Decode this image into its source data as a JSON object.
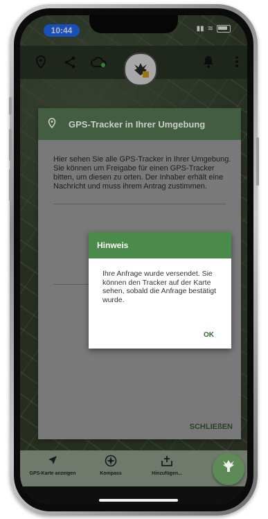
{
  "status_bar": {
    "time": "10:44"
  },
  "toolbar": {
    "icons": [
      "map-pin-icon",
      "share-icon",
      "cloud-sync-icon",
      "bell-icon",
      "more-vert-icon"
    ]
  },
  "gps_dialog": {
    "title": "GPS-Tracker in Ihrer Umgebung",
    "description": "Hier sehen Sie alle GPS-Tracker in Ihrer Umgebung. Sie können um Freigabe für einen GPS-Tracker bitten, um diesen zu orten. Der Inhaber erhält eine Nachricht und muss ihrem Antrag zustimmen.",
    "close_label": "SCHLIEßEN"
  },
  "hint_dialog": {
    "title": "Hinweis",
    "message": "Ihre Anfrage wurde versendet. Sie können den Tracker auf der Karte sehen, sobald die Anfrage bestätigt wurde.",
    "ok_label": "OK"
  },
  "bottom_nav": {
    "items": [
      {
        "label": "GPS-Karte anzeigen",
        "icon": "navigation-arrow-icon"
      },
      {
        "label": "Kompass",
        "icon": "compass-icon"
      },
      {
        "label": "Hinzufügen...",
        "icon": "add-box-icon"
      }
    ]
  },
  "colors": {
    "header_green": "#4c6a48",
    "hint_green": "#4a8a4a",
    "accent_text": "#2c6a2c",
    "time_pill": "#1f6fff"
  }
}
